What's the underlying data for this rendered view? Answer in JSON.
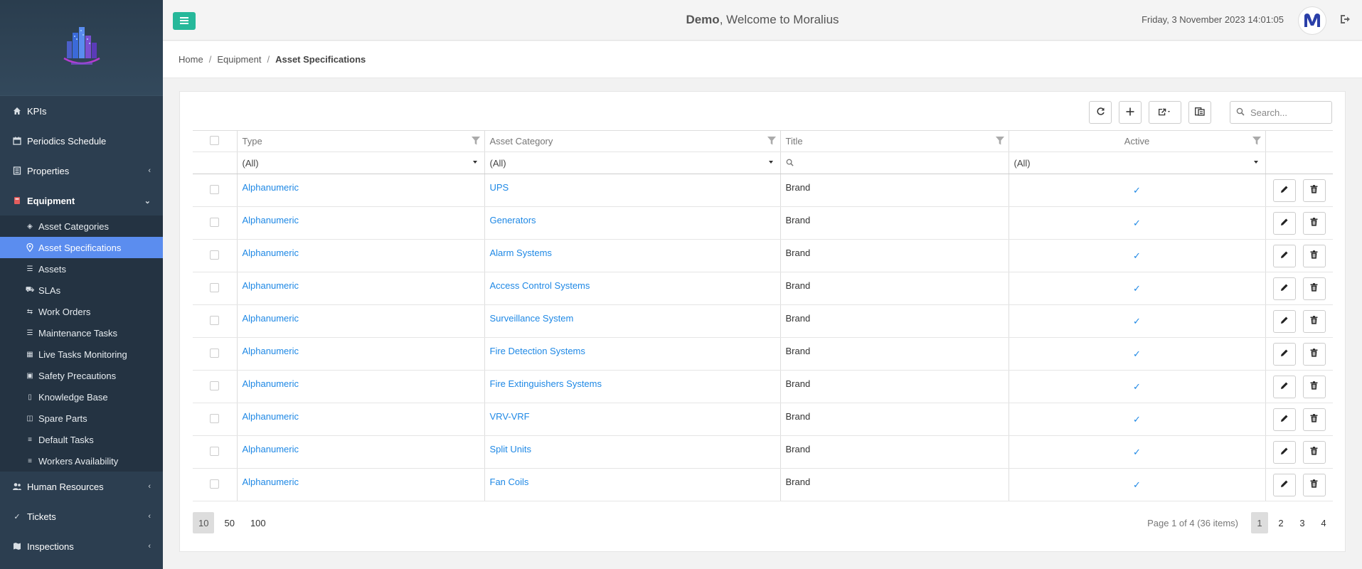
{
  "app": {
    "welcome_user": "Demo",
    "welcome_text": ", Welcome to Moralius",
    "datetime": "Friday, 3 November 2023 14:01:05"
  },
  "sidebar": {
    "items": [
      {
        "label": "KPIs",
        "icon": "home-icon"
      },
      {
        "label": "Periodics Schedule",
        "icon": "calendar-icon"
      },
      {
        "label": "Properties",
        "icon": "building-icon"
      },
      {
        "label": "Equipment",
        "icon": "equipment-icon"
      },
      {
        "label": "Human Resources",
        "icon": "users-icon"
      },
      {
        "label": "Tickets",
        "icon": "ticket-icon"
      },
      {
        "label": "Inspections",
        "icon": "map-icon"
      }
    ],
    "equipment_sub": [
      {
        "label": "Asset Categories"
      },
      {
        "label": "Asset Specifications"
      },
      {
        "label": "Assets"
      },
      {
        "label": "SLAs"
      },
      {
        "label": "Work Orders"
      },
      {
        "label": "Maintenance Tasks"
      },
      {
        "label": "Live Tasks Monitoring"
      },
      {
        "label": "Safety Precautions"
      },
      {
        "label": "Knowledge Base"
      },
      {
        "label": "Spare Parts"
      },
      {
        "label": "Default Tasks"
      },
      {
        "label": "Workers Availability"
      }
    ]
  },
  "breadcrumb": {
    "home": "Home",
    "equipment": "Equipment",
    "current": "Asset Specifications",
    "sep": "/"
  },
  "toolbar": {
    "search_placeholder": "Search..."
  },
  "grid": {
    "columns": {
      "type": "Type",
      "category": "Asset Category",
      "title": "Title",
      "active": "Active"
    },
    "filters": {
      "type": "(All)",
      "category": "(All)",
      "active": "(All)"
    },
    "rows": [
      {
        "type": "Alphanumeric",
        "category": "UPS",
        "title": "Brand",
        "active": "✓"
      },
      {
        "type": "Alphanumeric",
        "category": "Generators",
        "title": "Brand",
        "active": "✓"
      },
      {
        "type": "Alphanumeric",
        "category": "Alarm Systems",
        "title": "Brand",
        "active": "✓"
      },
      {
        "type": "Alphanumeric",
        "category": "Access Control Systems",
        "title": "Brand",
        "active": "✓"
      },
      {
        "type": "Alphanumeric",
        "category": "Surveillance System",
        "title": "Brand",
        "active": "✓"
      },
      {
        "type": "Alphanumeric",
        "category": "Fire Detection Systems",
        "title": "Brand",
        "active": "✓"
      },
      {
        "type": "Alphanumeric",
        "category": "Fire Extinguishers Systems",
        "title": "Brand",
        "active": "✓"
      },
      {
        "type": "Alphanumeric",
        "category": "VRV-VRF",
        "title": "Brand",
        "active": "✓"
      },
      {
        "type": "Alphanumeric",
        "category": "Split Units",
        "title": "Brand",
        "active": "✓"
      },
      {
        "type": "Alphanumeric",
        "category": "Fan Coils",
        "title": "Brand",
        "active": "✓"
      }
    ]
  },
  "pager": {
    "sizes": [
      "10",
      "50",
      "100"
    ],
    "selected_size": "10",
    "info": "Page 1 of 4 (36 items)",
    "pages": [
      "1",
      "2",
      "3",
      "4"
    ],
    "current_page": "1"
  },
  "colors": {
    "sidebar_bg": "#2c3e50",
    "active_item": "#5b8def",
    "hamburger": "#26b89a",
    "link": "#1e88e5"
  }
}
